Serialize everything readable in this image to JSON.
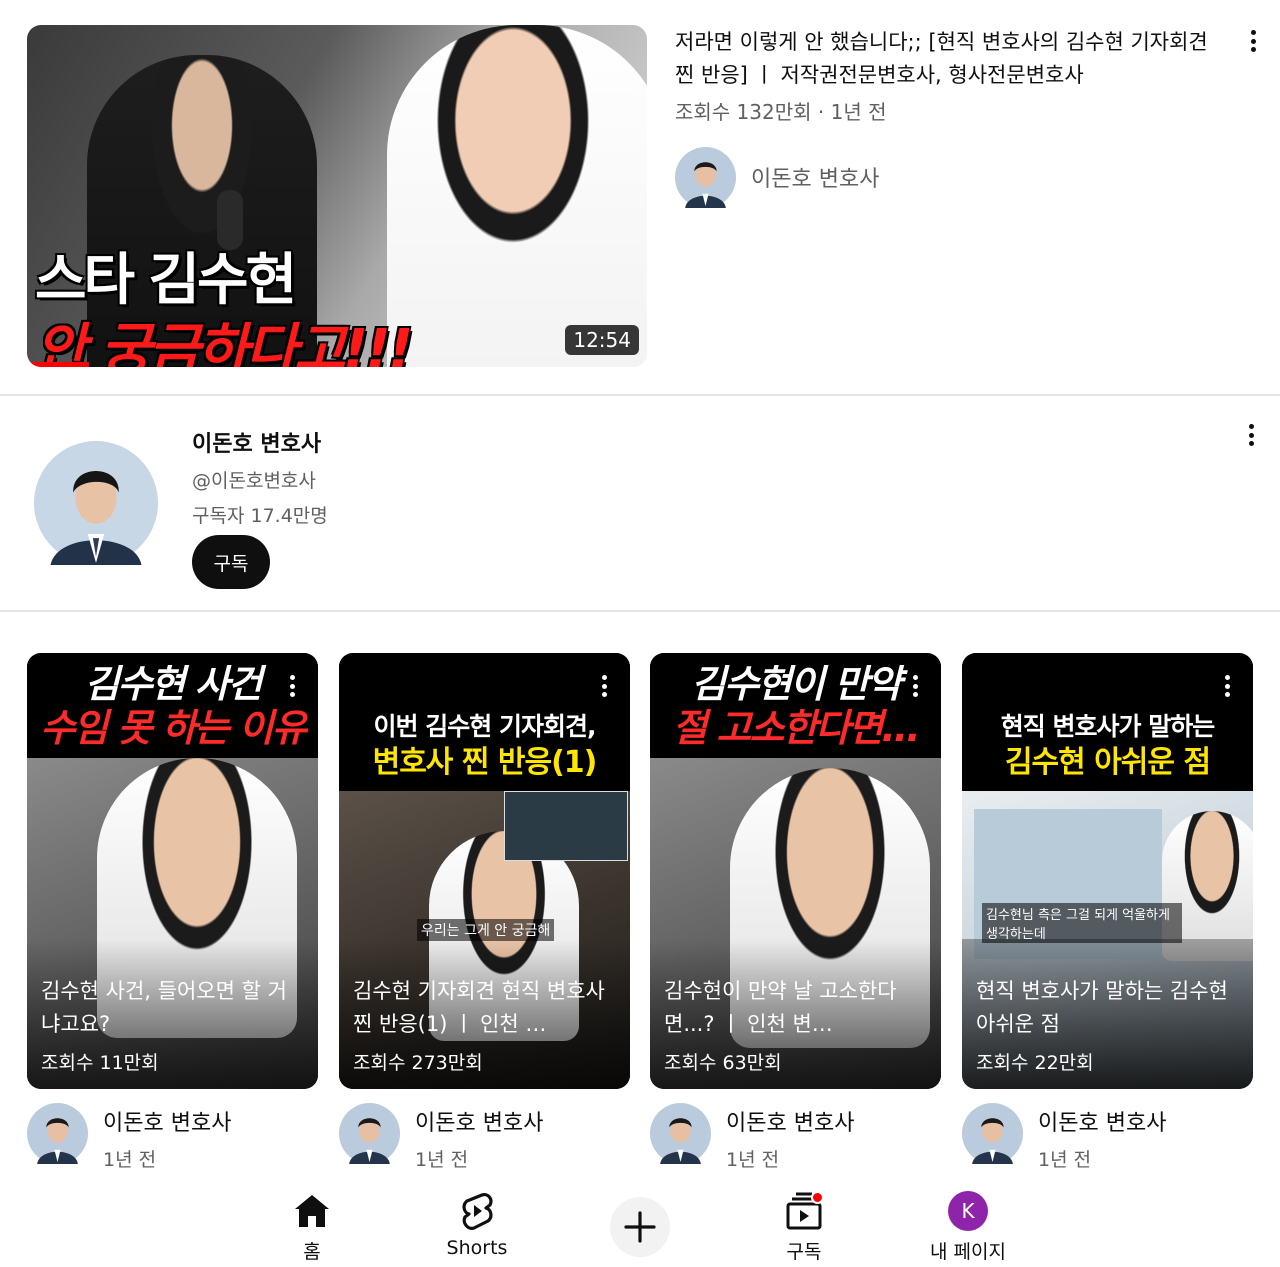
{
  "top_video": {
    "thumb_text_line1": "스타 김수현",
    "thumb_text_line2": "안 궁금하다고!!!",
    "duration": "12:54",
    "title": "저라면 이렇게 안 했습니다;; [현직 변호사의 김수현 기자회견 찐 반응] ㅣ 저작권전문변호사, 형사전문변호사",
    "meta": "조회수 132만회 · 1년 전",
    "channel_name": "이돈호 변호사",
    "menu_icon": "more-vert-icon"
  },
  "channel": {
    "name": "이돈호 변호사",
    "handle": "@이돈호변호사",
    "subscribers": "구독자 17.4만명",
    "subscribe_label": "구독"
  },
  "shorts": [
    {
      "banner_line1": "김수현 사건",
      "banner_line2": "수임 못 하는 이유",
      "title": "김수현 사건, 들어오면 할 거냐고요?",
      "views": "조회수 11만회",
      "channel": "이돈호 변호사",
      "age": "1년 전"
    },
    {
      "banner_line1": "이번 김수현 기자회견,",
      "banner_line2": "변호사 찐 반응(1)",
      "caption": "우리는 그게 안 궁금해",
      "title": "김수현 기자회견 현직 변호사 찐 반응(1) ㅣ 인천 …",
      "views": "조회수 273만회",
      "channel": "이돈호 변호사",
      "age": "1년 전"
    },
    {
      "banner_line1": "김수현이 만약",
      "banner_line2": "절 고소한다면...",
      "title": "김수현이 만약 날 고소한다면...? ㅣ 인천 변…",
      "views": "조회수 63만회",
      "channel": "이돈호 변호사",
      "age": "1년 전"
    },
    {
      "banner_line1": "현직 변호사가 말하는",
      "banner_line2": "김수현 아쉬운 점",
      "caption": "김수현님 측은 그걸 되게 억울하게 생각하는데",
      "title": "현직 변호사가 말하는 김수현 아쉬운 점",
      "views": "조회수 22만회",
      "channel": "이돈호 변호사",
      "age": "1년 전"
    }
  ],
  "bottom_nav": {
    "home": "홈",
    "shorts": "Shorts",
    "subscriptions": "구독",
    "you": "내 페이지",
    "avatar_letter": "K"
  },
  "colors": {
    "accent_red": "#ff0000",
    "text_primary": "#0f0f0f",
    "text_secondary": "#606060",
    "avatar_purple": "#8e24aa"
  }
}
